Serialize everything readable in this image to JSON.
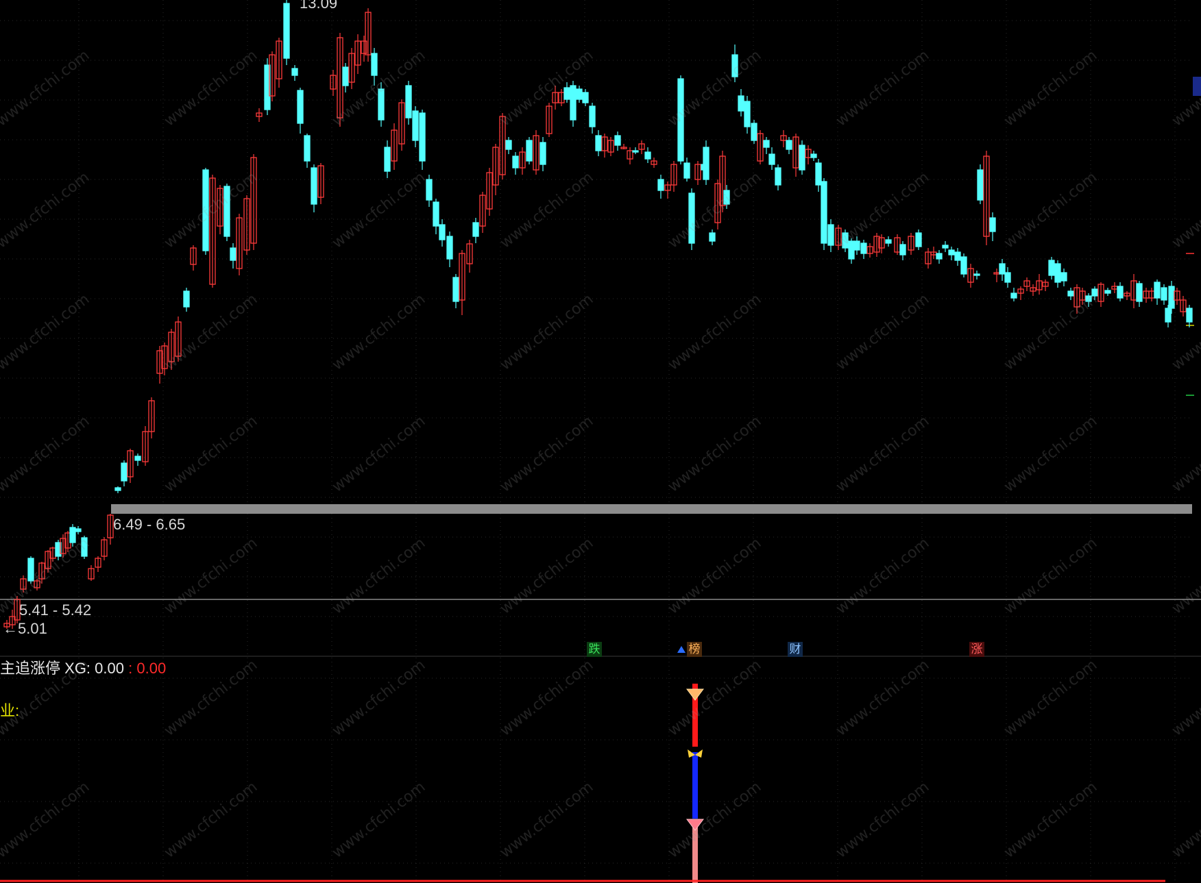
{
  "chart_data": {
    "type": "candlestick",
    "price_labels": {
      "top_high": "13.09",
      "zone_upper": "6.49 - 6.65",
      "zone_lower": "5.41 - 5.42",
      "bottom_low": "5.01"
    },
    "colors": {
      "up": "#ff3b3b",
      "down": "#54ffff",
      "zone_bar": "#8c8c8c",
      "separator": "#8a8a8a",
      "baseline": "#ff2020",
      "signal_top": "#ff1a1a",
      "signal_mid": "#1428ff",
      "signal_bottom": "#f08a8a"
    }
  },
  "event_badges": [
    {
      "text": "跌",
      "kind": "down"
    },
    {
      "text": "榜",
      "kind": "list"
    },
    {
      "text": "财",
      "kind": "fin"
    },
    {
      "text": "涨",
      "kind": "up"
    }
  ],
  "indicator": {
    "name": "主追涨停",
    "xg_label": "XG:",
    "xg_value": "0.00",
    "sep": ":",
    "xg_value2": "0.00",
    "industry_label": "业:"
  },
  "watermark": "www.cfchi.com"
}
